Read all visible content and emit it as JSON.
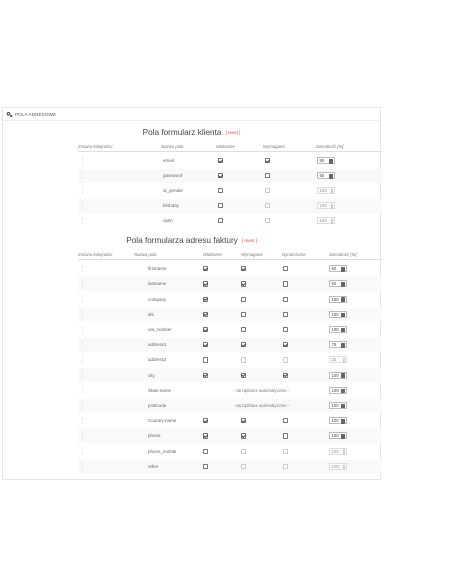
{
  "panel": {
    "title": "POLA ADRESOWE",
    "icon": "gears-icon"
  },
  "customer": {
    "title": "Pola formularz klienta",
    "reset": "[ reset ]",
    "headers": [
      "Zmiana kolejności",
      "Nazwa pola",
      "Widoczne",
      "Wymagane",
      "Szerokość [%]"
    ],
    "rows": [
      {
        "name": "email",
        "visible": true,
        "required": true,
        "req_disabled": false,
        "width": "50",
        "width_disabled": false
      },
      {
        "name": "password",
        "visible": true,
        "required": false,
        "req_disabled": false,
        "width": "50",
        "width_disabled": false
      },
      {
        "name": "id_gender",
        "visible": false,
        "required": false,
        "req_disabled": true,
        "width": "100",
        "width_disabled": true
      },
      {
        "name": "birthday",
        "visible": false,
        "required": false,
        "req_disabled": true,
        "width": "100",
        "width_disabled": true
      },
      {
        "name": "optin",
        "visible": false,
        "required": false,
        "req_disabled": true,
        "width": "100",
        "width_disabled": true
      }
    ]
  },
  "address": {
    "title": "Pola formularza adresu faktury",
    "reset": "[ reset ]",
    "headers": [
      "Zmiana kolejności",
      "Nazwa pola",
      "Widoczne",
      "Wymagane",
      "Dynamiczne",
      "Szerokość [%]"
    ],
    "auto_text": "- zarządzane automatycznie -",
    "rows": [
      {
        "name": "firstname",
        "visible": true,
        "required": true,
        "dynamic": false,
        "width": "50",
        "disabled": false
      },
      {
        "name": "lastname",
        "visible": true,
        "required": true,
        "dynamic": false,
        "width": "50",
        "disabled": false
      },
      {
        "name": "company",
        "visible": true,
        "required": false,
        "dynamic": false,
        "width": "100",
        "disabled": false
      },
      {
        "name": "dni",
        "visible": true,
        "required": false,
        "dynamic": false,
        "width": "100",
        "disabled": false
      },
      {
        "name": "vat_number",
        "visible": true,
        "required": false,
        "dynamic": false,
        "width": "100",
        "disabled": false
      },
      {
        "name": "address1",
        "visible": true,
        "required": true,
        "dynamic": true,
        "width": "75",
        "disabled": false
      },
      {
        "name": "address2",
        "visible": false,
        "required": false,
        "dynamic": false,
        "width": "25",
        "disabled": true
      },
      {
        "name": "city",
        "visible": true,
        "required": true,
        "dynamic": true,
        "width": "100",
        "disabled": false
      },
      {
        "name": "State:name",
        "auto": true,
        "width": "100"
      },
      {
        "name": "postcode",
        "auto": true,
        "width": "100"
      },
      {
        "name": "Country:name",
        "visible": true,
        "required": true,
        "dynamic": false,
        "width": "100",
        "disabled": false
      },
      {
        "name": "phone",
        "visible": true,
        "required": true,
        "dynamic": false,
        "width": "100",
        "disabled": false
      },
      {
        "name": "phone_mobile",
        "visible": false,
        "required": false,
        "dynamic": false,
        "width": "100",
        "disabled": true
      },
      {
        "name": "other",
        "visible": false,
        "required": false,
        "dynamic": false,
        "width": "100",
        "disabled": true
      }
    ]
  },
  "icons": {
    "sort": "sort-arrows-icon"
  }
}
